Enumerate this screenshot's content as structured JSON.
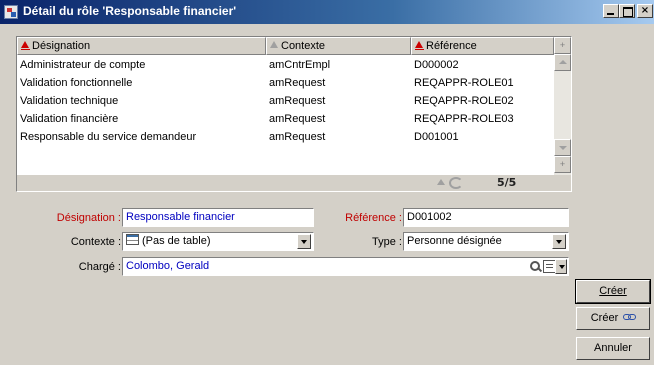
{
  "window": {
    "title": "Détail du rôle 'Responsable financier'"
  },
  "list": {
    "columns": [
      "Désignation",
      "Contexte",
      "Référence"
    ],
    "rows": [
      [
        "Administrateur de compte",
        "amCntrEmpl",
        "D000002"
      ],
      [
        "Validation fonctionnelle",
        "amRequest",
        "REQAPPR-ROLE01"
      ],
      [
        "Validation technique",
        "amRequest",
        "REQAPPR-ROLE02"
      ],
      [
        "Validation financière",
        "amRequest",
        "REQAPPR-ROLE03"
      ],
      [
        "Responsable du service demandeur",
        "amRequest",
        "D001001"
      ]
    ],
    "count": "5/5"
  },
  "form": {
    "designation_label": "Désignation :",
    "designation_value": "Responsable financier",
    "reference_label": "Référence :",
    "reference_value": "D001002",
    "contexte_label": "Contexte :",
    "contexte_value": "(Pas de table)",
    "type_label": "Type :",
    "type_value": "Personne désignée",
    "charge_label": "Chargé :",
    "charge_value": "Colombo, Gerald"
  },
  "buttons": {
    "create": "Créer",
    "create_link": "Créer",
    "cancel": "Annuler"
  },
  "colors": {
    "title_bar": "#0a246a",
    "required_label": "#c00000",
    "link_value": "#0000c0"
  }
}
